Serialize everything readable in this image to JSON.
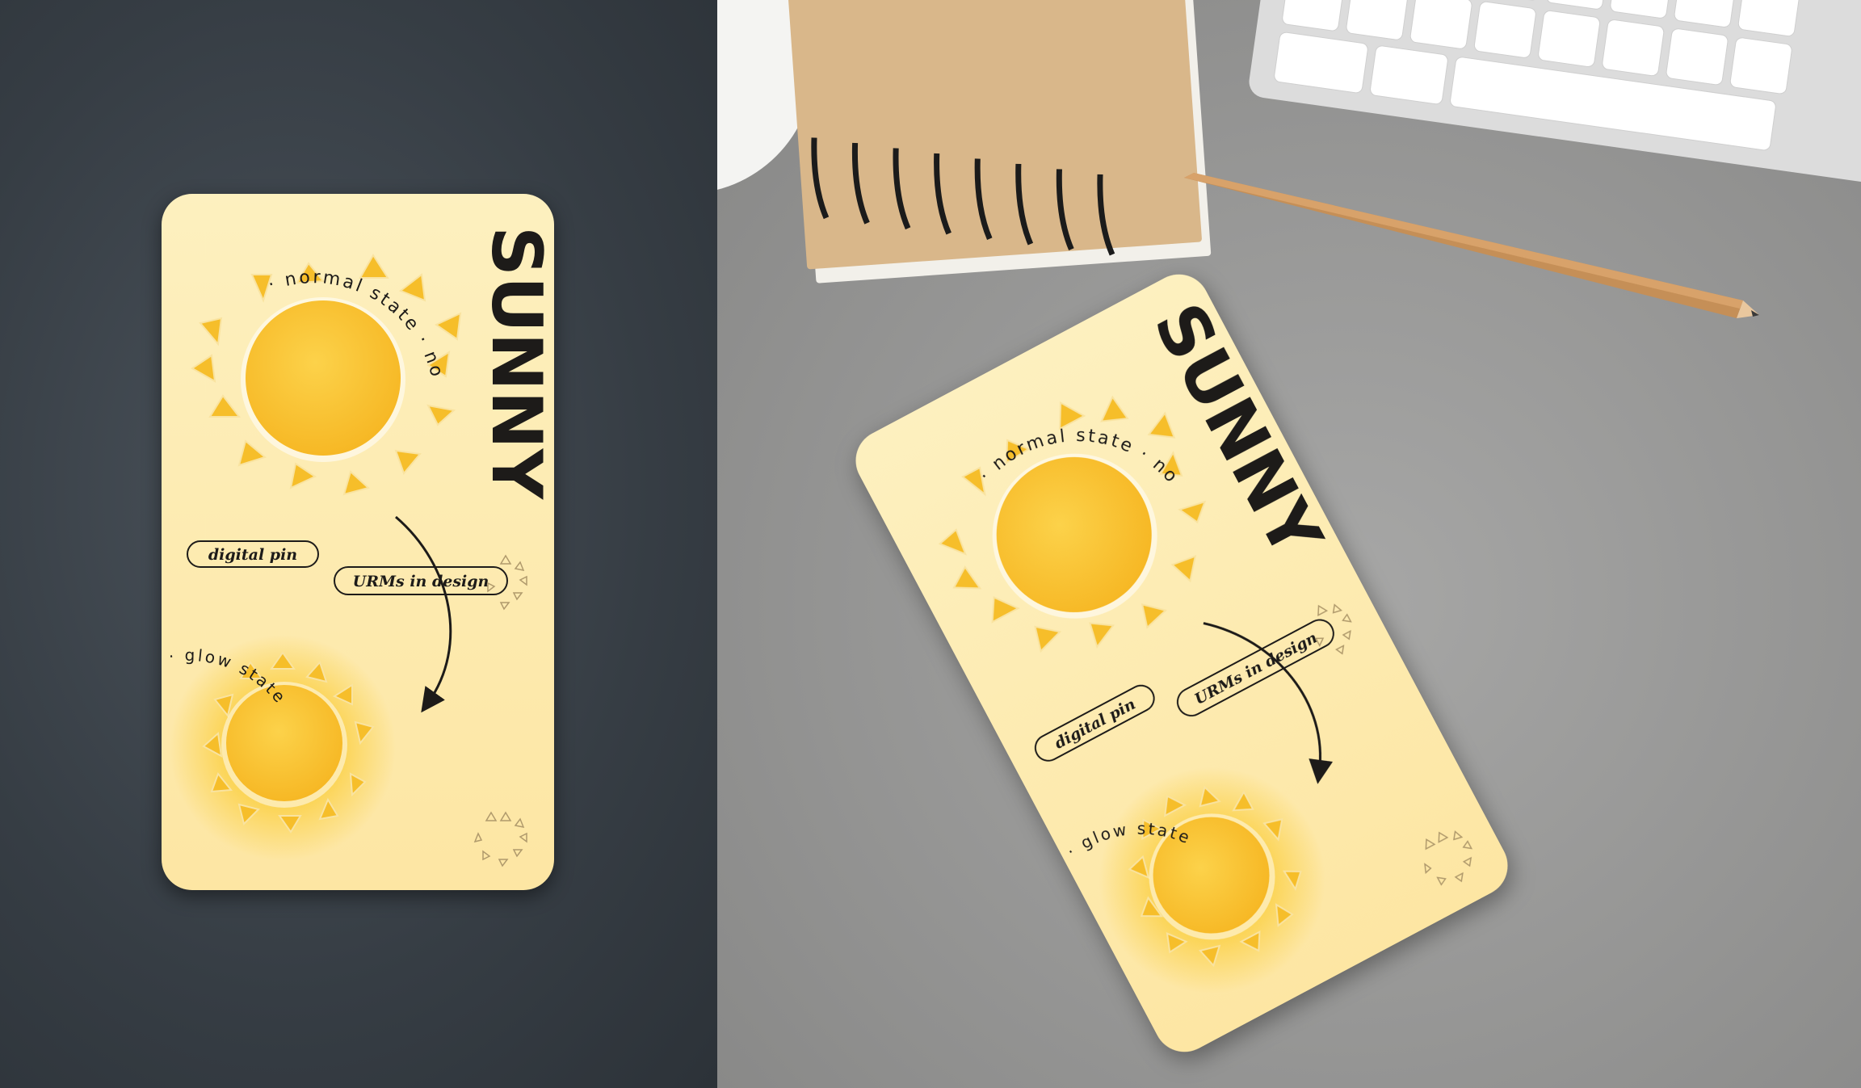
{
  "card": {
    "title": "SUNNY",
    "normal_label": "· normal state · normal state",
    "glow_label": "· glow state · glow state",
    "pin_label": "digital pin",
    "design_label": "URMs in design"
  },
  "colors": {
    "card": "#fdeeb8",
    "sun": "#f9c12b",
    "ray": "#f6be2a",
    "ink": "#1d1b19"
  },
  "mockups": [
    "flat card",
    "desk mockup"
  ]
}
